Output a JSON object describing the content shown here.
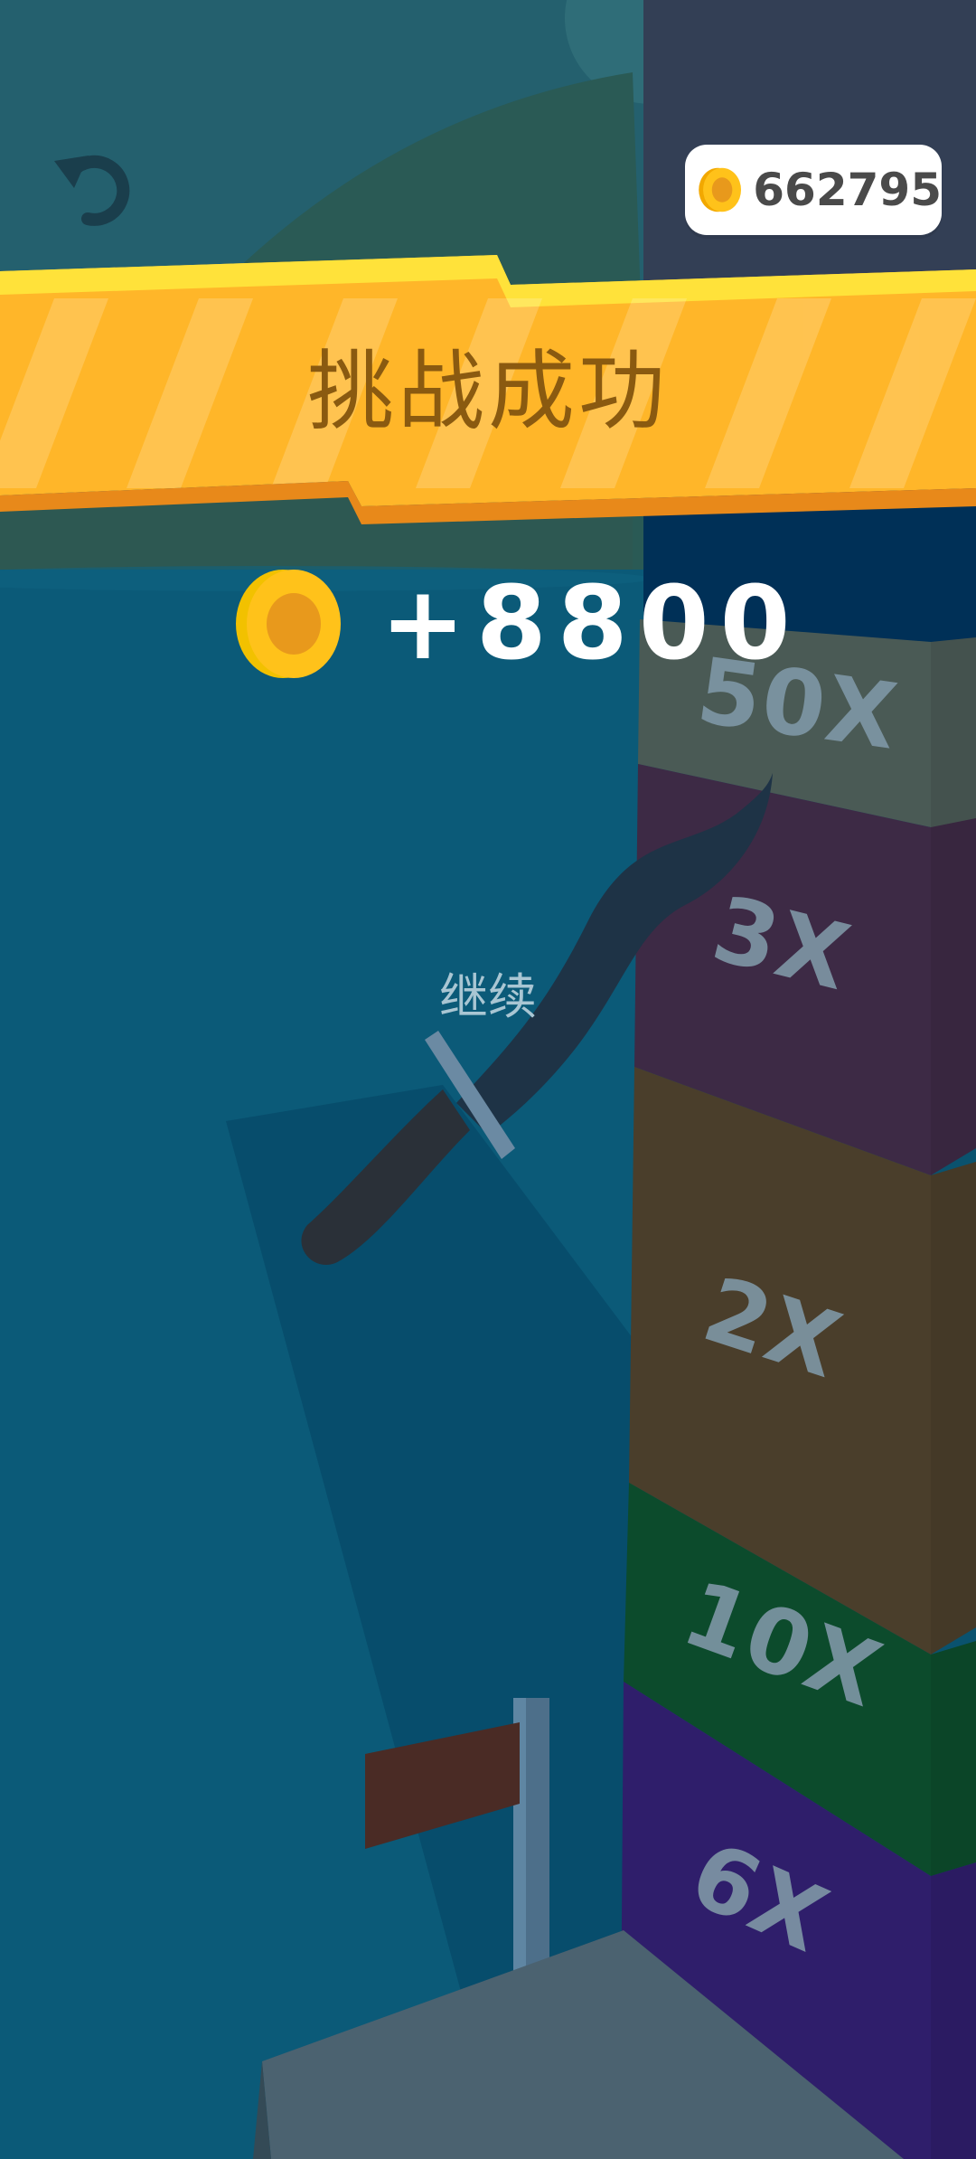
{
  "hud": {
    "coin_total": "662795",
    "restart_icon": "restart-icon"
  },
  "banner": {
    "title": "挑战成功"
  },
  "reward": {
    "amount": "+8800"
  },
  "continue_label": "继续",
  "tower": {
    "blocks": [
      {
        "label": "50X",
        "color": "#4a5a55"
      },
      {
        "label": "3X",
        "color": "#3d2a45"
      },
      {
        "label": "2X",
        "color": "#4a3e2b"
      },
      {
        "label": "10X",
        "color": "#0c4b2c"
      },
      {
        "label": "6X",
        "color": "#2f1e6b"
      }
    ]
  },
  "colors": {
    "sky": "#24606e",
    "water": "#0b5a78",
    "banner": "#ffb629",
    "coin": "#ffc21a"
  }
}
